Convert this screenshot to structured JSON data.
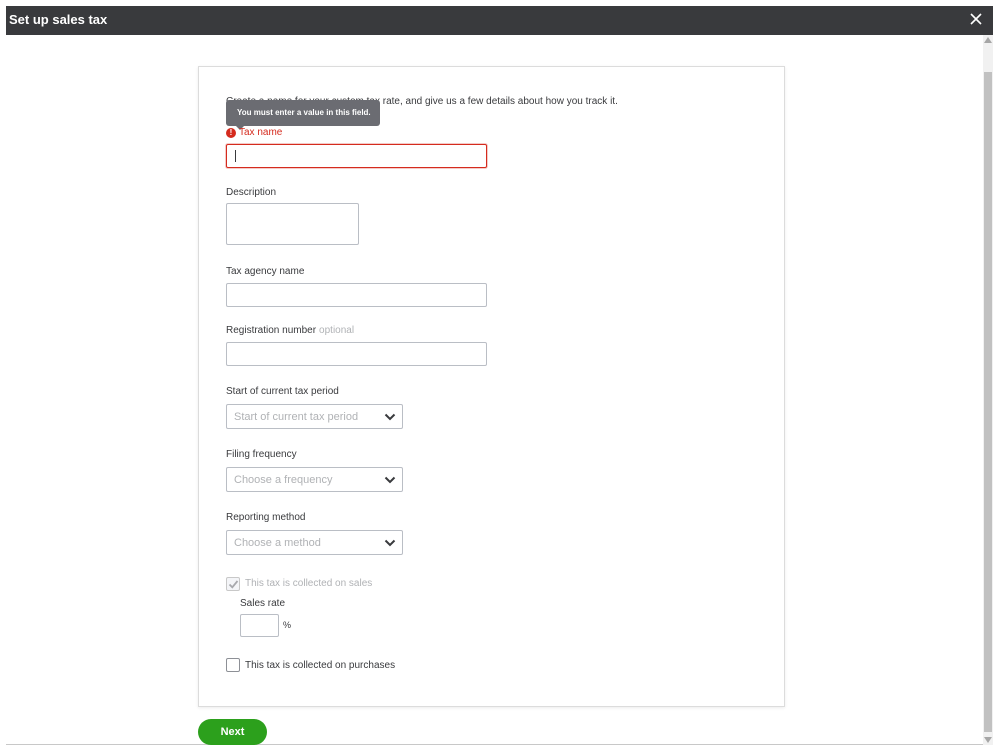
{
  "window": {
    "title": "Set up sales tax",
    "close_icon": "close-icon"
  },
  "form": {
    "intro": "Create a name for your custom tax rate, and give us a few details about how you track it.",
    "tooltip": "You must enter a value in this field.",
    "tax_name": {
      "label": "Tax name",
      "value": "",
      "error": true
    },
    "description": {
      "label": "Description",
      "value": ""
    },
    "tax_agency_name": {
      "label": "Tax agency name",
      "value": ""
    },
    "registration_number": {
      "label": "Registration number",
      "optional": "optional",
      "value": ""
    },
    "start_period": {
      "label": "Start of current tax period",
      "placeholder": "Start of current tax period"
    },
    "filing_frequency": {
      "label": "Filing frequency",
      "placeholder": "Choose a frequency"
    },
    "reporting_method": {
      "label": "Reporting method",
      "placeholder": "Choose a method"
    },
    "collected_on_sales": {
      "label": "This tax is collected on sales",
      "checked": true,
      "disabled": true
    },
    "sales_rate": {
      "label": "Sales rate",
      "value": "",
      "unit": "%"
    },
    "collected_on_purchases": {
      "label": "This tax is collected on purchases",
      "checked": false
    }
  },
  "footer": {
    "next_label": "Next"
  },
  "colors": {
    "titlebar": "#393a3d",
    "error": "#d52b1e",
    "primary_button": "#2ca01c"
  }
}
